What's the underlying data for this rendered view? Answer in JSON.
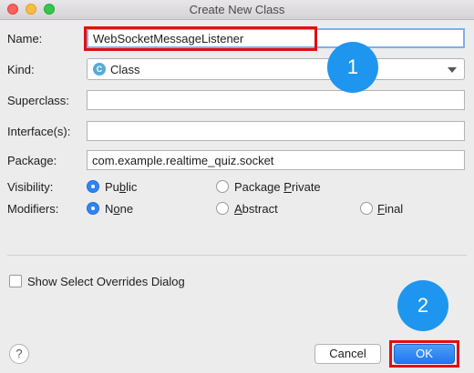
{
  "window": {
    "title": "Create New Class"
  },
  "form": {
    "name_label": "Name:",
    "name_value": "WebSocketMessageListener",
    "kind_label": "Kind:",
    "kind_value": "Class",
    "kind_icon_letter": "C",
    "superclass_label": "Superclass:",
    "superclass_value": "",
    "interfaces_label": "Interface(s):",
    "interfaces_value": "",
    "package_label": "Package:",
    "package_value": "com.example.realtime_quiz.socket"
  },
  "visibility": {
    "label": "Visibility:",
    "options": [
      {
        "pre": "Pu",
        "ul": "b",
        "post": "lic",
        "selected": true
      },
      {
        "pre": "Package ",
        "ul": "P",
        "post": "rivate",
        "selected": false
      }
    ]
  },
  "modifiers": {
    "label": "Modifiers:",
    "options": [
      {
        "pre": "N",
        "ul": "o",
        "post": "ne",
        "selected": true
      },
      {
        "pre": "",
        "ul": "A",
        "post": "bstract",
        "selected": false
      },
      {
        "pre": "",
        "ul": "F",
        "post": "inal",
        "selected": false
      }
    ]
  },
  "options": {
    "show_overrides_label": "Show Select Overrides Dialog",
    "show_overrides_checked": false
  },
  "footer": {
    "help_label": "?",
    "cancel_label": "Cancel",
    "ok_label": "OK"
  },
  "annotations": {
    "step1": "1",
    "step2": "2",
    "badge_color": "#1e96f0",
    "highlight_color": "#e01010"
  }
}
